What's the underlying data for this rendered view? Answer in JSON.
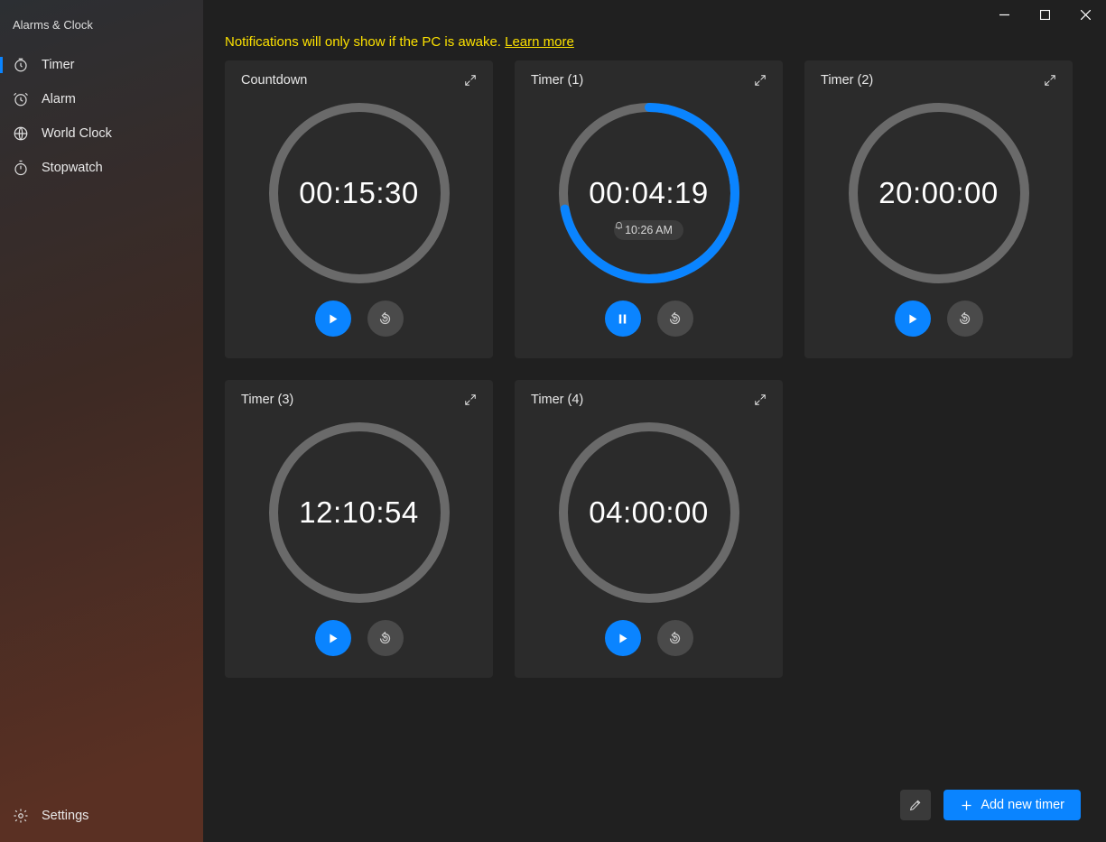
{
  "app_title": "Alarms & Clock",
  "sidebar": {
    "items": [
      {
        "label": "Timer",
        "selected": true
      },
      {
        "label": "Alarm",
        "selected": false
      },
      {
        "label": "World Clock",
        "selected": false
      },
      {
        "label": "Stopwatch",
        "selected": false
      }
    ],
    "settings_label": "Settings"
  },
  "notice": {
    "text": "Notifications will only show if the PC is awake. ",
    "link": "Learn more"
  },
  "timers": [
    {
      "title": "Countdown",
      "time": "00:15:30",
      "progress": 0,
      "state": "paused",
      "completion": null
    },
    {
      "title": "Timer (1)",
      "time": "00:04:19",
      "progress": 0.72,
      "state": "running",
      "completion": "10:26 AM"
    },
    {
      "title": "Timer (2)",
      "time": "20:00:00",
      "progress": 0,
      "state": "paused",
      "completion": null
    },
    {
      "title": "Timer (3)",
      "time": "12:10:54",
      "progress": 0,
      "state": "paused",
      "completion": null
    },
    {
      "title": "Timer (4)",
      "time": "04:00:00",
      "progress": 0,
      "state": "paused",
      "completion": null
    }
  ],
  "footer": {
    "add_label": "Add new timer"
  }
}
